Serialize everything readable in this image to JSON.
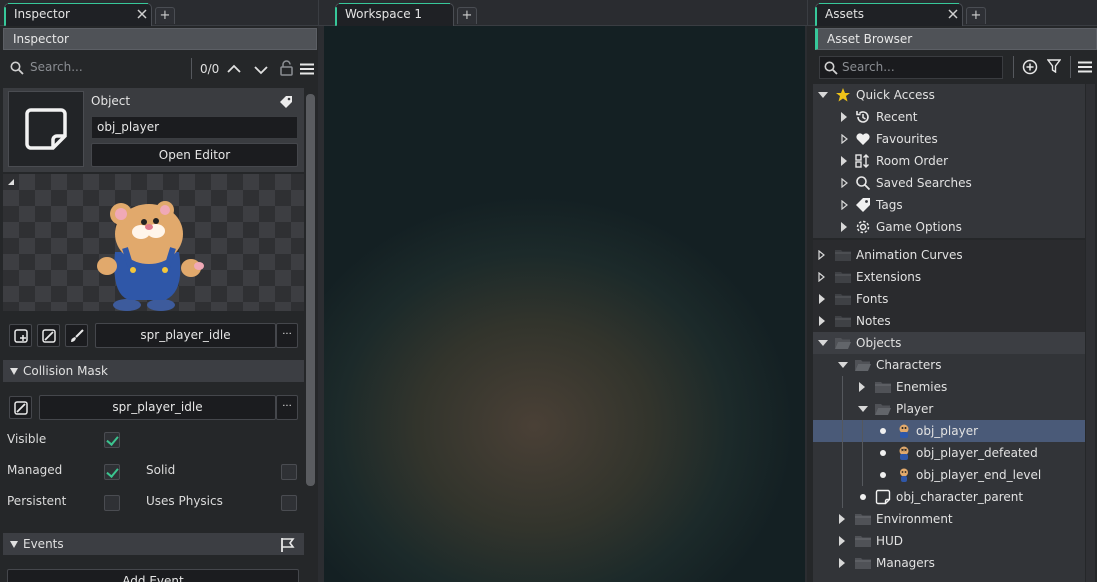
{
  "inspector": {
    "tab_label": "Inspector",
    "header": "Inspector",
    "search_placeholder": "Search...",
    "match_count": "0/0",
    "object_label": "Object",
    "object_name": "obj_player",
    "open_editor": "Open Editor",
    "sprite_name": "spr_player_idle",
    "more": "···",
    "collision_section": "Collision Mask",
    "mask_sprite": "spr_player_idle",
    "props": {
      "visible": {
        "label": "Visible",
        "checked": true
      },
      "managed": {
        "label": "Managed",
        "checked": true
      },
      "solid": {
        "label": "Solid",
        "checked": false
      },
      "persistent": {
        "label": "Persistent",
        "checked": false
      },
      "uses_physics": {
        "label": "Uses Physics",
        "checked": false
      }
    },
    "events_section": "Events",
    "add_event": "Add Event"
  },
  "workspace": {
    "tab_label": "Workspace 1"
  },
  "assets": {
    "tab_label": "Assets",
    "header": "Asset Browser",
    "search_placeholder": "Search...",
    "quick_access": {
      "label": "Quick Access",
      "items": [
        "Recent",
        "Favourites",
        "Room Order",
        "Saved Searches",
        "Tags",
        "Game Options"
      ]
    },
    "tree": {
      "animation_curves": "Animation Curves",
      "extensions": "Extensions",
      "fonts": "Fonts",
      "notes": "Notes",
      "objects": "Objects",
      "characters": "Characters",
      "enemies": "Enemies",
      "player": "Player",
      "obj_player": "obj_player",
      "obj_player_defeated": "obj_player_defeated",
      "obj_player_end_level": "obj_player_end_level",
      "obj_character_parent": "obj_character_parent",
      "environment": "Environment",
      "hud": "HUD",
      "managers": "Managers"
    }
  },
  "colors": {
    "accent": "#37c89a",
    "selected_row": "#4a5a78",
    "panel_bg": "#252729"
  }
}
